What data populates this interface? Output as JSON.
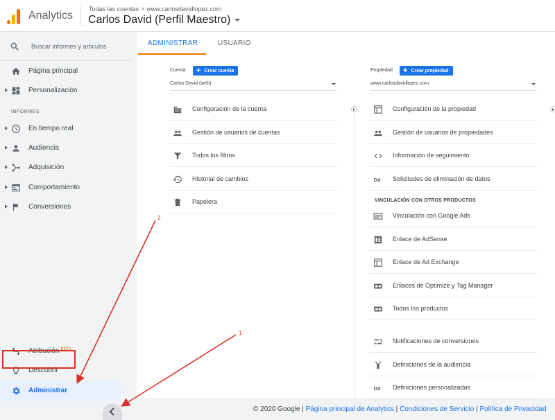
{
  "header": {
    "app_name": "Analytics",
    "breadcrumb_accounts": "Todas las cuentas",
    "breadcrumb_sep": ">",
    "breadcrumb_site": "www.carlosdavidlopez.com",
    "profile_name": "Carlos David (Perfil Maestro)",
    "logo_colors": [
      "#f9ab00",
      "#e37400"
    ]
  },
  "sidebar": {
    "search_placeholder": "Buscar informes y artículos",
    "main_items": [
      {
        "label": "Página principal",
        "icon": "home-icon"
      },
      {
        "label": "Personalización",
        "icon": "dashboard-icon"
      }
    ],
    "reports_title": "INFORMES",
    "report_items": [
      {
        "label": "En tiempo real",
        "icon": "clock-icon"
      },
      {
        "label": "Audiencia",
        "icon": "person-icon"
      },
      {
        "label": "Adquisición",
        "icon": "acquisition-icon"
      },
      {
        "label": "Comportamiento",
        "icon": "behavior-icon"
      },
      {
        "label": "Conversiones",
        "icon": "flag-icon"
      }
    ],
    "bottom_items": [
      {
        "label": "Atribución",
        "badge": "BETA",
        "icon": "attribution-icon"
      },
      {
        "label": "Descubrir",
        "icon": "lightbulb-icon"
      },
      {
        "label": "Administrar",
        "icon": "gear-icon"
      }
    ]
  },
  "tabs": {
    "admin": "ADMINISTRAR",
    "user": "USUARIO"
  },
  "account": {
    "header_label": "Cuenta",
    "create_button": "Crear cuenta",
    "selected": "Carlos David (web)",
    "items": [
      {
        "label": "Configuración de la cuenta",
        "icon": "building-icon"
      },
      {
        "label": "Gestión de usuarios de cuentas",
        "icon": "group-icon"
      },
      {
        "label": "Todos los filtros",
        "icon": "filter-icon"
      },
      {
        "label": "Historial de cambios",
        "icon": "history-icon"
      },
      {
        "label": "Papelera",
        "icon": "trash-icon"
      }
    ]
  },
  "property": {
    "header_label": "Propiedad",
    "create_button": "Crear propiedad",
    "selected": "www.carlosdavidlopez.com",
    "items": [
      {
        "label": "Configuración de la propiedad",
        "icon": "window-icon"
      },
      {
        "label": "Gestión de usuarios de propiedades",
        "icon": "group-icon"
      },
      {
        "label": "Información de seguimiento",
        "icon": "code-icon"
      },
      {
        "label": "Solicitudes de eliminación de datos",
        "icon": "dd-icon"
      }
    ],
    "linking_title": "VINCULACIÓN CON OTROS PRODUCTOS",
    "linking_items": [
      {
        "label": "Vinculación con Google Ads",
        "icon": "ads-icon"
      },
      {
        "label": "Enlace de AdSense",
        "icon": "adsense-icon"
      },
      {
        "label": "Enlace de Ad Exchange",
        "icon": "window-icon"
      },
      {
        "label": "Enlaces de Optimize y Tag Manager",
        "icon": "optimize-icon"
      },
      {
        "label": "Todos los productos",
        "icon": "products-icon"
      }
    ],
    "other_items": [
      {
        "label": "Notificaciones de conversiones",
        "icon": "postback-icon"
      },
      {
        "label": "Definiciones de la audiencia",
        "icon": "audience-def-icon"
      },
      {
        "label": "Definiciones personalizadas",
        "icon": "dd-icon"
      }
    ]
  },
  "footer": {
    "copyright": "© 2020 Google |",
    "link_home": "Página principal de Analytics",
    "sep": "|",
    "link_terms": "Condiciones de Servicio",
    "link_privacy": "Política de Privacidad"
  },
  "annotations": {
    "label_1": "1",
    "label_2": "2",
    "color": "#d93025"
  },
  "colors": {
    "accent": "#1a73e8",
    "tab_underline": "#e37400"
  }
}
